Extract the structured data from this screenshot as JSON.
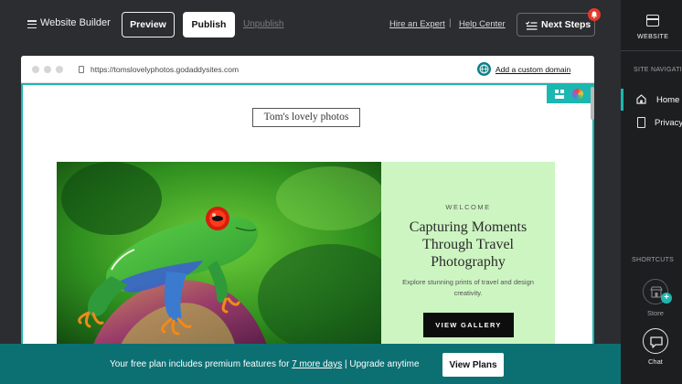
{
  "header": {
    "app_title": "Website Builder",
    "preview_label": "Preview",
    "publish_label": "Publish",
    "unpublish_label": "Unpublish",
    "hire_label": "Hire an Expert",
    "separator": "|",
    "help_label": "Help Center",
    "next_steps_label": "Next Steps",
    "next_steps_badge_icon": "notification-dot"
  },
  "browser": {
    "url": "https://tomslovelyphotos.godaddysites.com",
    "add_domain_label": "Add a custom domain"
  },
  "site": {
    "title": "Tom's lovely photos",
    "hero": {
      "eyebrow": "WELCOME",
      "heading": "Capturing Moments Through Travel Photography",
      "subtext": "Explore stunning prints of travel and design creativity.",
      "button_label": "VIEW GALLERY",
      "image_subject": "red-eyed tree frog on a flower"
    }
  },
  "sidebar": {
    "website_label": "WEBSITE",
    "site_nav_label": "SITE NAVIGATION",
    "nav_items": [
      {
        "label": "Home",
        "icon": "home-icon",
        "active": true
      },
      {
        "label": "Privacy",
        "icon": "page-icon",
        "active": false
      }
    ],
    "shortcuts_label": "SHORTCUTS",
    "store_label": "Store",
    "chat_label": "Chat"
  },
  "banner": {
    "text_before": "Your free plan includes premium features for ",
    "link_text": "7 more days",
    "text_after": " | Upgrade anytime",
    "button_label": "View Plans"
  },
  "colors": {
    "accent": "#1bb7b0",
    "banner": "#0c7073",
    "hero_panel": "#cdf5c2",
    "badge": "#e03b2f"
  }
}
